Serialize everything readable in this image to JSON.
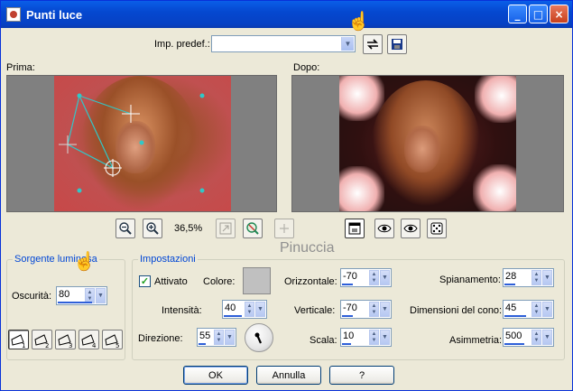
{
  "window": {
    "title": "Punti luce"
  },
  "titlebar_buttons": {
    "minimize": "_",
    "maximize": "□",
    "close": "×"
  },
  "preset": {
    "label": "Imp. predef.:",
    "value": ""
  },
  "panes": {
    "before_label": "Prima:",
    "after_label": "Dopo:"
  },
  "zoom": {
    "value": "36,5%"
  },
  "watermark": "Pinuccia",
  "source": {
    "group_label": "Sorgente luminosa",
    "darkness_label": "Oscurità:",
    "darkness_value": "80",
    "lights": [
      "1",
      "2",
      "3",
      "4",
      "5"
    ]
  },
  "settings": {
    "group_label": "Impostazioni",
    "enabled_label": "Attivato",
    "enabled": true,
    "color_label": "Colore:",
    "color": "#c0c0c0",
    "intensity_label": "Intensità:",
    "intensity_value": "40",
    "direction_label": "Direzione:",
    "direction_value": "55",
    "horizontal_label": "Orizzontale:",
    "horizontal_value": "-70",
    "vertical_label": "Verticale:",
    "vertical_value": "-70",
    "scale_label": "Scala:",
    "scale_value": "10",
    "smoothing_label": "Spianamento:",
    "smoothing_value": "28",
    "cone_label": "Dimensioni del cono:",
    "cone_value": "45",
    "asymmetry_label": "Asimmetria:",
    "asymmetry_value": "500"
  },
  "buttons": {
    "ok": "OK",
    "cancel": "Annulla",
    "help": "?"
  },
  "colors": {
    "title_blue": "#0548d0",
    "group_label": "#0046d5",
    "photo_red": "#c84848",
    "handle_cyan": "#30c8c8"
  }
}
